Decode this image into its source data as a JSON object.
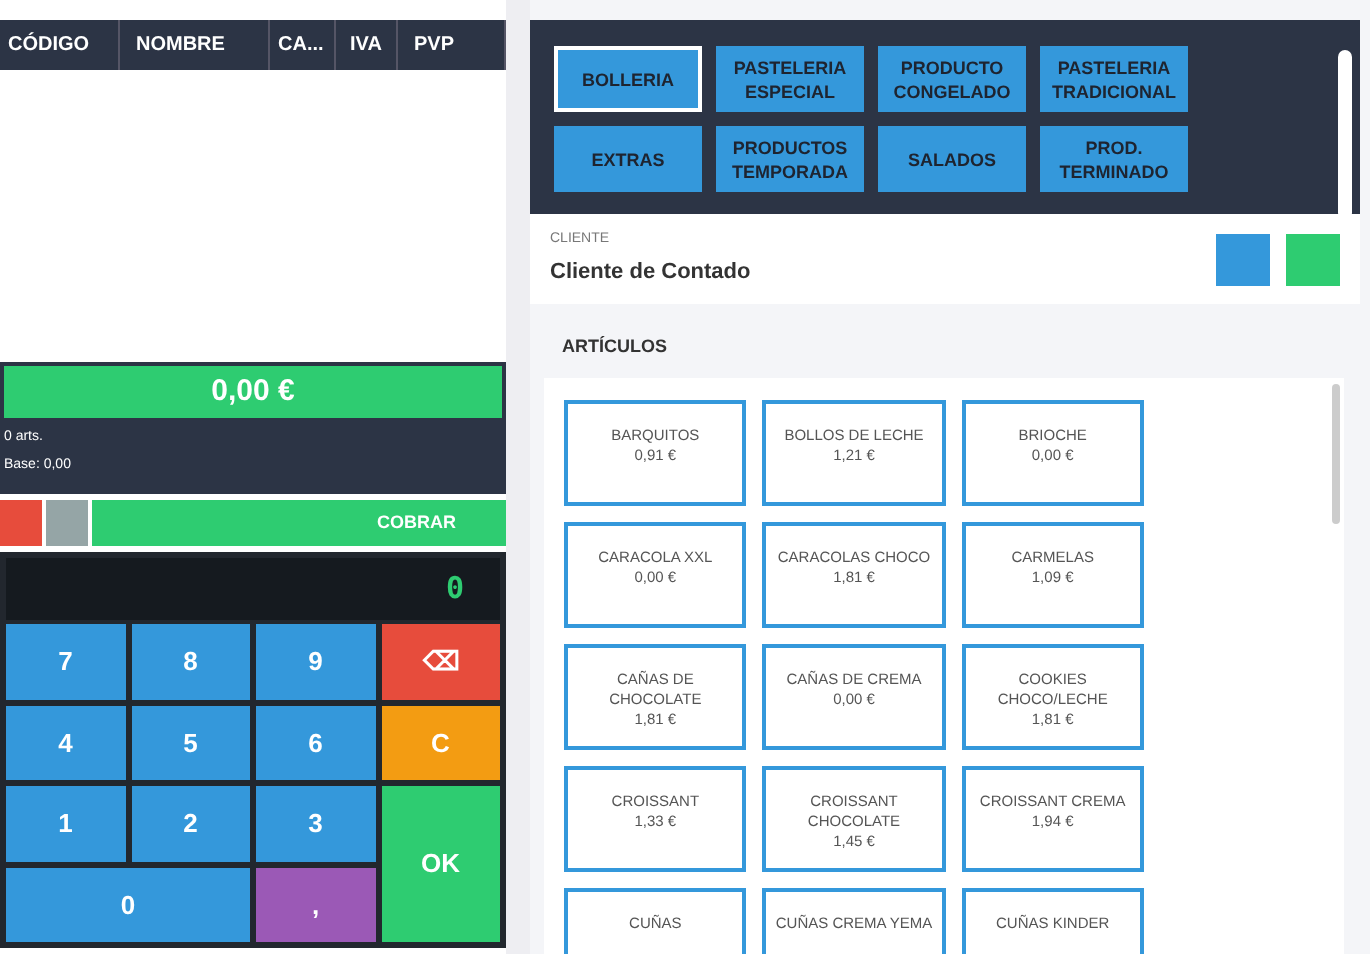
{
  "order_table": {
    "columns": [
      "CÓDIGO",
      "NOMBRE",
      "CA...",
      "IVA",
      "PVP"
    ]
  },
  "totals": {
    "amount": "0,00 €",
    "items": "0 arts.",
    "base": "Base: 0,00"
  },
  "actions": {
    "charge": "COBRAR"
  },
  "keypad": {
    "display": "0",
    "keys": [
      {
        "label": "7",
        "kind": "digit"
      },
      {
        "label": "8",
        "kind": "digit"
      },
      {
        "label": "9",
        "kind": "digit"
      },
      {
        "label": "⌫",
        "kind": "delete"
      },
      {
        "label": "4",
        "kind": "digit"
      },
      {
        "label": "5",
        "kind": "digit"
      },
      {
        "label": "6",
        "kind": "digit"
      },
      {
        "label": "C",
        "kind": "clear"
      },
      {
        "label": "1",
        "kind": "digit"
      },
      {
        "label": "2",
        "kind": "digit"
      },
      {
        "label": "3",
        "kind": "digit"
      },
      {
        "label": "OK",
        "kind": "ok"
      },
      {
        "label": "0",
        "kind": "zero"
      },
      {
        "label": ",",
        "kind": "decimal"
      }
    ]
  },
  "categories": [
    {
      "label": "BOLLERIA",
      "selected": true
    },
    {
      "label": "PASTELERIA ESPECIAL",
      "selected": false
    },
    {
      "label": "PRODUCTO CONGELADO",
      "selected": false
    },
    {
      "label": "PASTELERIA TRADICIONAL",
      "selected": false
    },
    {
      "label": "EXTRAS",
      "selected": false
    },
    {
      "label": "PRODUCTOS TEMPORADA",
      "selected": false
    },
    {
      "label": "SALADOS",
      "selected": false
    },
    {
      "label": "PROD. TERMINADO",
      "selected": false
    }
  ],
  "client": {
    "label": "CLIENTE",
    "name": "Cliente de Contado"
  },
  "articles": {
    "title": "ARTÍCULOS",
    "items": [
      {
        "name": "BARQUITOS",
        "price": "0,91 €"
      },
      {
        "name": "BOLLOS DE LECHE",
        "price": "1,21 €"
      },
      {
        "name": "BRIOCHE",
        "price": "0,00 €"
      },
      {
        "name": "CARACOLA XXL",
        "price": "0,00 €"
      },
      {
        "name": "CARACOLAS CHOCO",
        "price": "1,81 €"
      },
      {
        "name": "CARMELAS",
        "price": "1,09 €"
      },
      {
        "name": "CAÑAS DE CHOCOLATE",
        "price": "1,81 €"
      },
      {
        "name": "CAÑAS DE CREMA",
        "price": "0,00 €"
      },
      {
        "name": "COOKIES CHOCO/LECHE",
        "price": "1,81 €"
      },
      {
        "name": "CROISSANT",
        "price": "1,33 €"
      },
      {
        "name": "CROISSANT CHOCOLATE",
        "price": "1,45 €"
      },
      {
        "name": "CROISSANT CREMA",
        "price": "1,94 €"
      },
      {
        "name": "CUÑAS"
      },
      {
        "name": "CUÑAS CREMA YEMA"
      },
      {
        "name": "CUÑAS KINDER"
      }
    ]
  }
}
